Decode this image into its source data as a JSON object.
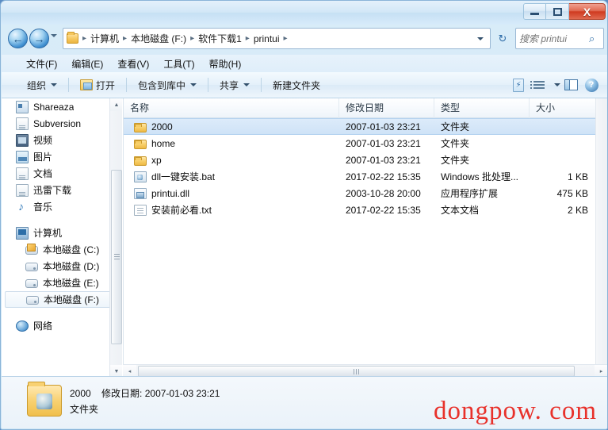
{
  "window": {
    "title": "",
    "buttons": {
      "minimize": "–",
      "maximize": "□",
      "close": "X"
    }
  },
  "address": {
    "back_icon": "←",
    "forward_icon": "→",
    "recent_caret": "▼",
    "folder_icon": "folder-icon",
    "crumbs": [
      "计算机",
      "本地磁盘 (F:)",
      "软件下载1",
      "printui"
    ],
    "separator": "▸",
    "refresh_icon": "↻",
    "search_placeholder": "搜索 printui",
    "search_value": "",
    "search_icon": "⌕"
  },
  "menubar": {
    "items": [
      "文件(F)",
      "编辑(E)",
      "查看(V)",
      "工具(T)",
      "帮助(H)"
    ]
  },
  "toolbar": {
    "organize": "组织",
    "open": "打开",
    "include_library": "包含到库中",
    "share": "共享",
    "new_folder": "新建文件夹",
    "burn_icon": "burn-icon",
    "views_icon": "views-icon",
    "preview_icon": "preview-pane-icon",
    "help_icon": "?"
  },
  "sidebar": {
    "items": [
      {
        "label": "Shareaza",
        "icon": "shareaza-icon",
        "indent": 1,
        "selected": false
      },
      {
        "label": "Subversion",
        "icon": "document-icon",
        "indent": 1,
        "selected": false
      },
      {
        "label": "视频",
        "icon": "video-icon",
        "indent": 1,
        "selected": false
      },
      {
        "label": "图片",
        "icon": "picture-icon",
        "indent": 1,
        "selected": false
      },
      {
        "label": "文档",
        "icon": "document-icon",
        "indent": 1,
        "selected": false
      },
      {
        "label": "迅雷下载",
        "icon": "document-icon",
        "indent": 1,
        "selected": false
      },
      {
        "label": "音乐",
        "icon": "music-icon",
        "indent": 1,
        "selected": false
      },
      {
        "label": "",
        "icon": "spacer",
        "indent": 1,
        "selected": false
      },
      {
        "label": "计算机",
        "icon": "computer-icon",
        "indent": 1,
        "selected": false
      },
      {
        "label": "本地磁盘 (C:)",
        "icon": "drive-windows-icon",
        "indent": 2,
        "selected": false
      },
      {
        "label": "本地磁盘 (D:)",
        "icon": "drive-icon",
        "indent": 2,
        "selected": false
      },
      {
        "label": "本地磁盘 (E:)",
        "icon": "drive-icon",
        "indent": 2,
        "selected": false
      },
      {
        "label": "本地磁盘 (F:)",
        "icon": "drive-icon",
        "indent": 2,
        "selected": true
      },
      {
        "label": "",
        "icon": "spacer",
        "indent": 1,
        "selected": false
      },
      {
        "label": "网络",
        "icon": "network-icon",
        "indent": 1,
        "selected": false
      }
    ],
    "scroll_up": "▲",
    "scroll_down": "▼"
  },
  "filelist": {
    "columns": [
      "名称",
      "修改日期",
      "类型",
      "大小"
    ],
    "rows": [
      {
        "name": "2000",
        "date": "2007-01-03 23:21",
        "type": "文件夹",
        "size": "",
        "icon": "folder-icon",
        "selected": true
      },
      {
        "name": "home",
        "date": "2007-01-03 23:21",
        "type": "文件夹",
        "size": "",
        "icon": "folder-icon",
        "selected": false
      },
      {
        "name": "xp",
        "date": "2007-01-03 23:21",
        "type": "文件夹",
        "size": "",
        "icon": "folder-icon",
        "selected": false
      },
      {
        "name": "dll一键安装.bat",
        "date": "2017-02-22 15:35",
        "type": "Windows 批处理...",
        "size": "1 KB",
        "icon": "bat-file-icon",
        "selected": false
      },
      {
        "name": "printui.dll",
        "date": "2003-10-28 20:00",
        "type": "应用程序扩展",
        "size": "475 KB",
        "icon": "dll-file-icon",
        "selected": false
      },
      {
        "name": "安装前必看.txt",
        "date": "2017-02-22 15:35",
        "type": "文本文档",
        "size": "2 KB",
        "icon": "txt-file-icon",
        "selected": false
      }
    ],
    "hscroll_left": "◂",
    "hscroll_right": "▸"
  },
  "details": {
    "name": "2000",
    "date_label": "修改日期:",
    "date_value": "2007-01-03 23:21",
    "type": "文件夹",
    "icon": "folder-large-icon"
  },
  "watermark": {
    "text": "dongpow. com",
    "color": "#e8312b"
  }
}
